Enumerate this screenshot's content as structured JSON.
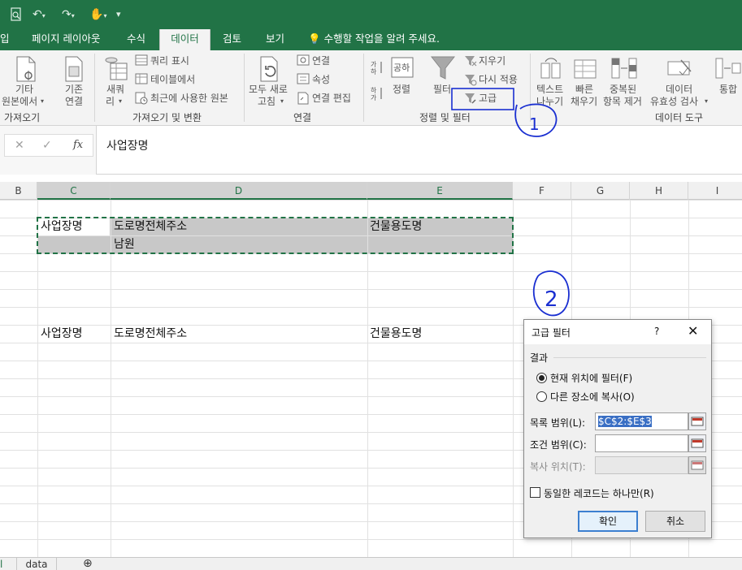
{
  "ribbon_tabs": [
    "입",
    "페이지 레이아웃",
    "수식",
    "데이터",
    "검토",
    "보기"
  ],
  "active_tab": "데이터",
  "tell_me": "수행할 작업을 알려 주세요.",
  "ribbon": {
    "get_external": {
      "line1": "기타",
      "line2": "원본에서",
      "line3": "가져오기"
    },
    "existing": {
      "line1": "기존",
      "line2": "연결"
    },
    "new_query": {
      "line1": "새쿼",
      "line2": "리"
    },
    "show_queries": "쿼리 표시",
    "from_table": "테이블에서",
    "recent_sources": "최근에 사용한 원본",
    "group_get_transform": "가져오기 및 변환",
    "refresh_all": {
      "line1": "모두 새로",
      "line2": "고침"
    },
    "connections": "연결",
    "properties": "속성",
    "edit_links": "연결 편집",
    "group_connections": "연결",
    "sort": "정렬",
    "filter": "필터",
    "clear": "지우기",
    "reapply": "다시 적용",
    "advanced": "고급",
    "group_sort_filter": "정렬 및 필터",
    "text_to_columns": {
      "line1": "텍스트",
      "line2": "나누기"
    },
    "flash_fill": {
      "line1": "빠른",
      "line2": "채우기"
    },
    "remove_duplicates": {
      "line1": "중복된",
      "line2": "항목 제거"
    },
    "data_validation": {
      "line1": "데이터",
      "line2": "유효성 검사"
    },
    "consolidate": "통합",
    "group_data_tools": "데이터 도구"
  },
  "formula_bar": {
    "value": "사업장명",
    "fx": "fx"
  },
  "columns": [
    "B",
    "C",
    "D",
    "E",
    "F",
    "G",
    "H",
    "I"
  ],
  "criteria": {
    "headers": [
      "사업장명",
      "도로명전체주소",
      "건물용도명"
    ],
    "values": [
      "",
      "남원",
      ""
    ]
  },
  "data_headers": [
    "사업장명",
    "도로명전체주소",
    "건물용도명"
  ],
  "sheets": [
    "data"
  ],
  "dialog": {
    "title": "고급 필터",
    "help": "?",
    "section": "결과",
    "option_inplace": "현재 위치에 필터(F)",
    "option_copy": "다른 장소에 복사(O)",
    "list_range_label": "목록 범위(L):",
    "list_range_value": "$C$2:$E$3",
    "criteria_range_label": "조건 범위(C):",
    "criteria_range_value": "",
    "copy_to_label": "복사 위치(T):",
    "copy_to_value": "",
    "unique_label": "동일한 레코드는 하나만(R)",
    "ok": "확인",
    "cancel": "취소"
  },
  "annotations": {
    "step1": "1",
    "step2": "2",
    "color": "#1a2fd1"
  },
  "colors": {
    "excel_green": "#217346",
    "ribbon_bg": "#f3f3f3"
  }
}
